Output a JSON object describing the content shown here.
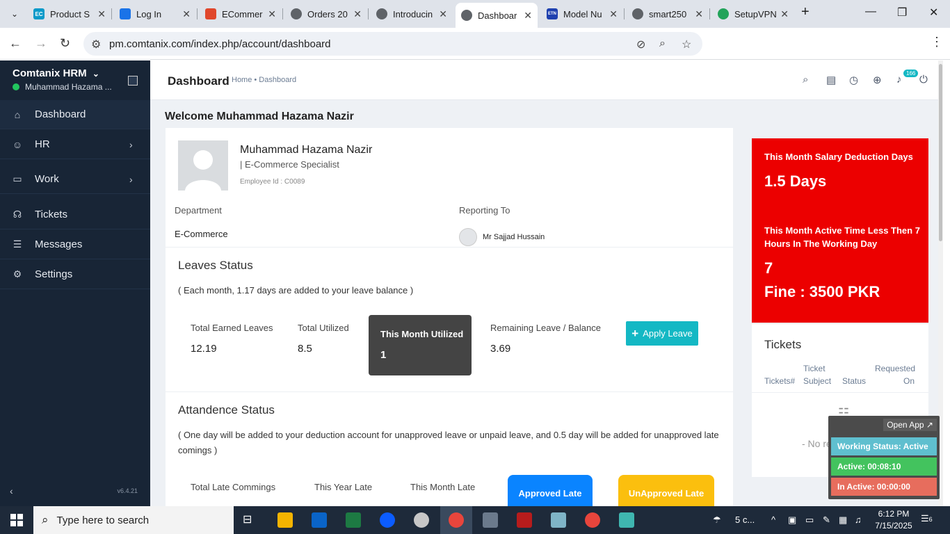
{
  "browser": {
    "tabs": [
      {
        "label": "Product S",
        "favicon": "EC",
        "color": "#0a9ac9"
      },
      {
        "label": "Log In",
        "favicon": "",
        "color": "#1a73e8"
      },
      {
        "label": "ECommer",
        "favicon": "",
        "color": "#e0472c"
      },
      {
        "label": "Orders 20",
        "favicon": "",
        "color": "#5f6368"
      },
      {
        "label": "Introducin",
        "favicon": "",
        "color": "#5f6368"
      },
      {
        "label": "Dashboar",
        "favicon": "",
        "color": "#5f6368"
      },
      {
        "label": "Model Nu",
        "favicon": "ETN",
        "color": "#1e40af"
      },
      {
        "label": "smart250",
        "favicon": "",
        "color": "#5f6368"
      },
      {
        "label": "SetupVPN",
        "favicon": "",
        "color": "#22a35a"
      }
    ],
    "url": "pm.comtanix.com/index.php/account/dashboard"
  },
  "sidebar": {
    "brand": "Comtanix HRM",
    "user": "Muhammad Hazama ...",
    "items": [
      {
        "label": "Dashboard",
        "icon": "home-icon"
      },
      {
        "label": "HR",
        "icon": "users-icon"
      },
      {
        "label": "Work",
        "icon": "briefcase-icon"
      },
      {
        "label": "Tickets",
        "icon": "headset-icon"
      },
      {
        "label": "Messages",
        "icon": "message-icon"
      },
      {
        "label": "Settings",
        "icon": "gear-icon"
      }
    ],
    "version": "v6.4.21"
  },
  "header": {
    "title": "Dashboard",
    "breadcrumb": "Home • Dashboard",
    "notification_count": "166"
  },
  "welcome": "Welcome Muhammad Hazama Nazir",
  "profile": {
    "name": "Muhammad Hazama Nazir",
    "role": "| E-Commerce Specialist",
    "employee_id": "Employee Id : C0089",
    "department_label": "Department",
    "department": "E-Commerce",
    "reporting_label": "Reporting To",
    "reporting_to": "Mr Sajjad Hussain"
  },
  "leaves": {
    "title": "Leaves Status",
    "note": "( Each month, 1.17 days are added to your leave balance )",
    "earned_label": "Total Earned Leaves",
    "earned": "12.19",
    "utilized_label": "Total Utilized",
    "utilized": "8.5",
    "month_label": "This Month Utilized",
    "month": "1",
    "remaining_label": "Remaining Leave / Balance",
    "remaining": "3.69",
    "apply_label": "Apply Leave"
  },
  "attendance": {
    "title": "Attandence Status",
    "note": "( One day will be added to your deduction account for unapproved leave or unpaid leave, and 0.5 day will be added for unapproved late comings )",
    "late_label": "Total Late Commings",
    "year_label": "This Year Late",
    "month_label": "This Month Late",
    "approved_label": "Approved Late",
    "unapproved_label": "UnApproved Late"
  },
  "deduction": {
    "salary_title": "This Month Salary Deduction Days",
    "salary_value": "1.5 Days",
    "active_title": "This Month Active Time Less Then 7 Hours In The Working Day",
    "active_value": "7",
    "fine": "Fine : 3500 PKR"
  },
  "tickets": {
    "title": "Tickets",
    "col1": "Tickets#",
    "col2a": "Ticket",
    "col2b": "Subject",
    "col3": "Status",
    "col4a": "Requested",
    "col4b": "On",
    "empty": "- No record found"
  },
  "widget": {
    "open_app": "Open App ↗",
    "status": "Working Status: Active",
    "active": "Active: 00:08:10",
    "inactive": "In Active: 00:00:00"
  },
  "taskbar": {
    "search_placeholder": "Type here to search",
    "weather": "5 c...",
    "time": "6:12 PM",
    "date": "7/15/2025",
    "notifications": "6"
  },
  "colors": {
    "sidebar": "#182536",
    "accent": "#14b8c4",
    "danger": "#ec0000",
    "approved": "#0a84ff",
    "unapproved": "#fbbf0e"
  }
}
